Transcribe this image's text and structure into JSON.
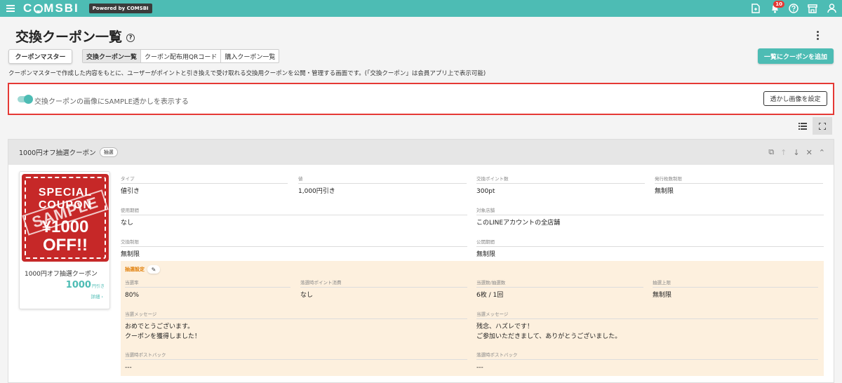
{
  "app": {
    "logo_text_a": "C",
    "logo_text_b": "MSBI",
    "powered_by": "Powered by COMSBI",
    "notification_count": "10",
    "accent_color": "#4dbcb4"
  },
  "header": {
    "title": "交換クーポン一覧",
    "master_button": "クーポンマスター",
    "tabs": [
      {
        "label": "交換クーポン一覧",
        "active": true
      },
      {
        "label": "クーポン配布用QRコード",
        "active": false
      },
      {
        "label": "購入クーポン一覧",
        "active": false
      }
    ],
    "add_button": "一覧にクーポンを追加",
    "description": "クーポンマスターで作成した内容をもとに、ユーザーがポイントと引き換えで受け取れる交換用クーポンを公開・管理する画面です。(「交換クーポン」は会員アプリ上で表示可能)"
  },
  "watermark": {
    "toggle_on": true,
    "label": "交換クーポンの画像にSAMPLE透かしを表示する",
    "button": "透かし画像を設定"
  },
  "coupon": {
    "title": "1000円オフ抽選クーポン",
    "badge": "抽選",
    "image": {
      "line1": "SPECIAL",
      "line2": "COUPON",
      "line3": "¥1000",
      "line4": "OFF!!",
      "watermark": "SAMPLE"
    },
    "preview_name": "1000円オフ抽選クーポン",
    "preview_value": "1000",
    "preview_unit": "円引き",
    "preview_link": "詳細 ›",
    "fields": {
      "type_label": "タイプ",
      "type_value": "値引き",
      "value_label": "値",
      "value_value": "1,000円引き",
      "points_label": "交換ポイント数",
      "points_value": "300pt",
      "limit_label": "発行枚数制限",
      "limit_value": "無制限",
      "period_label": "使用期間",
      "period_value": "なし",
      "store_label": "対象店舗",
      "store_value": "このLINEアカウントの全店舗",
      "exchange_limit_label": "交換制限",
      "exchange_limit_value": "無制限",
      "publish_label": "公開期間",
      "publish_value": "無制限"
    },
    "lottery": {
      "title": "抽選設定",
      "rate_label": "当選率",
      "rate_value": "80%",
      "lose_points_label": "落選時ポイント消費",
      "lose_points_value": "なし",
      "count_label": "当選数/抽選数",
      "count_value": "6枚 / 1回",
      "cap_label": "抽選上限",
      "cap_value": "無制限",
      "win_msg_label": "当選メッセージ",
      "win_msg_line1": "おめでとうございます。",
      "win_msg_line2": "クーポンを獲得しました！",
      "lose_msg_label": "当選メッセージ",
      "lose_msg_line1": "残念、ハズレです！",
      "lose_msg_line2": "ご参加いただきまして、ありがとうございました。",
      "win_postback_label": "当選時ポストバック",
      "win_postback_value": "---",
      "lose_postback_label": "落選時ポストバック",
      "lose_postback_value": "---"
    }
  }
}
